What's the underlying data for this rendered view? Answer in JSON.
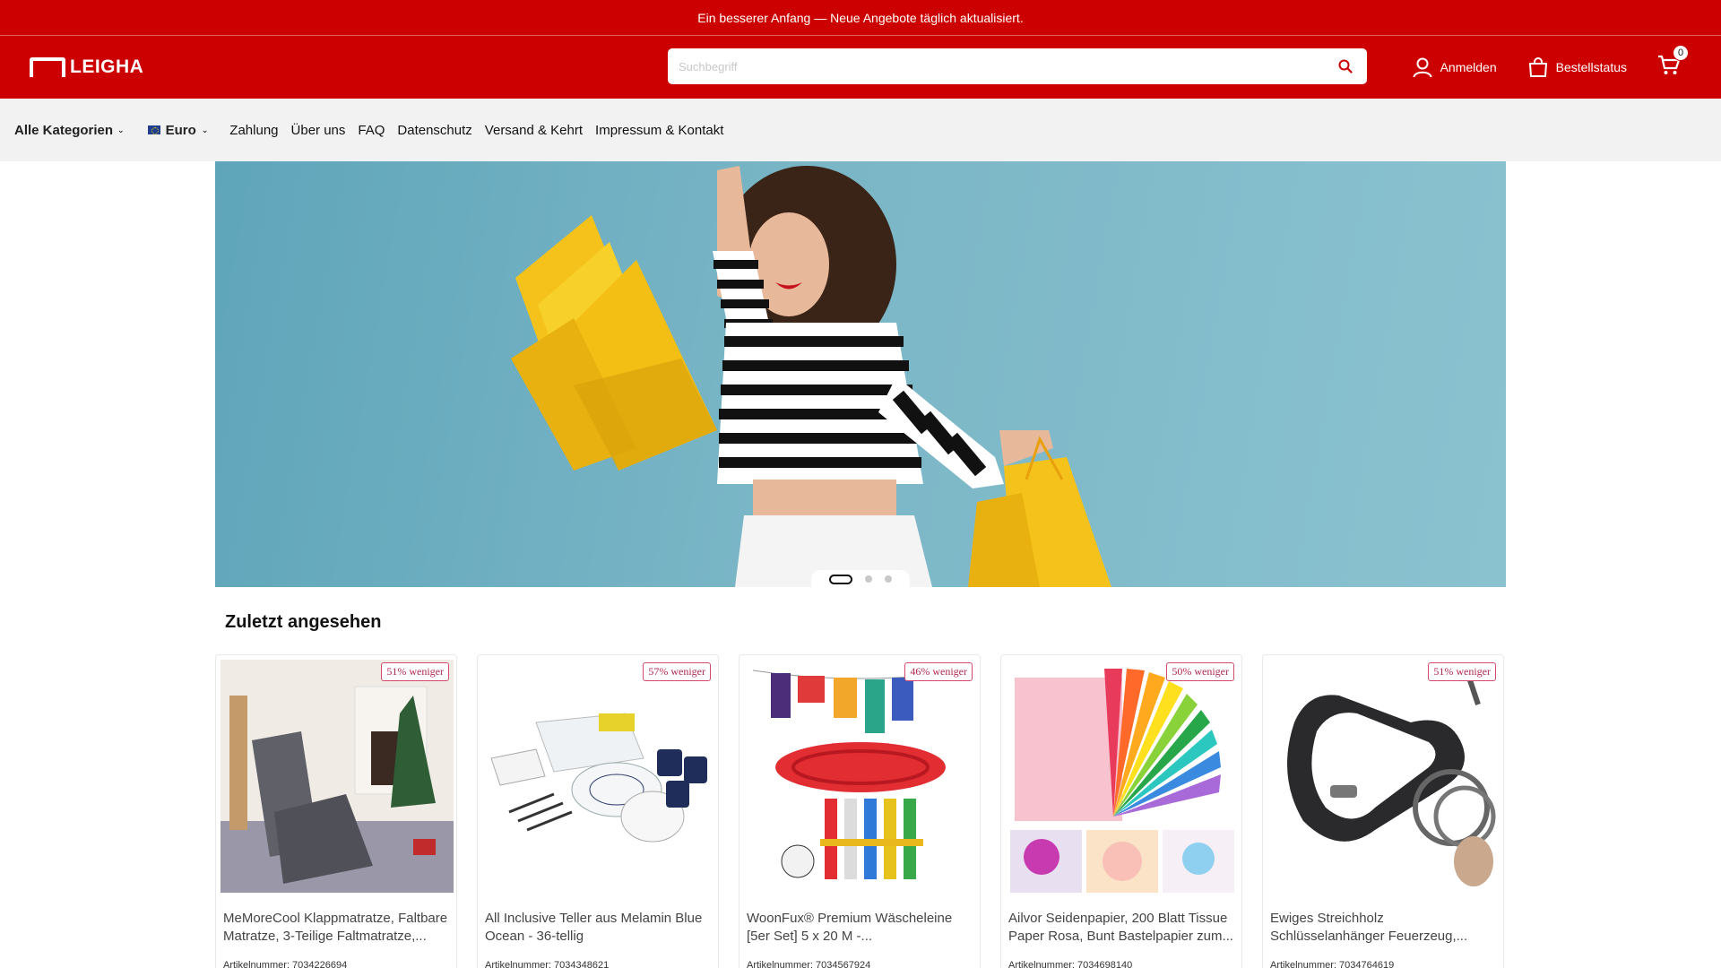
{
  "announcement": "Ein besserer Anfang — Neue Angebote täglich aktualisiert.",
  "header": {
    "logo_text": "LEIGHA",
    "search_placeholder": "Suchbegriff",
    "login_label": "Anmelden",
    "order_status_label": "Bestellstatus",
    "cart_count": "0"
  },
  "nav": {
    "categories_label": "Alle Kategorien",
    "currency_label": "Euro",
    "links": [
      "Zahlung",
      "Über uns",
      "FAQ",
      "Datenschutz",
      "Versand & Kehrt",
      "Impressum & Kontakt"
    ]
  },
  "hero": {
    "slide_count": 3,
    "active_slide": 1
  },
  "recent": {
    "title": "Zuletzt angesehen",
    "items": [
      {
        "discount": "51% weniger",
        "title": "MeMoreCool Klappmatratze, Faltbare Matratze, 3-Teilige Faltmatratze,...",
        "sku": "Artikelnummer: 7034226694"
      },
      {
        "discount": "57% weniger",
        "title": "All Inclusive Teller aus Melamin Blue Ocean - 36-tellig",
        "sku": "Artikelnummer: 7034348621"
      },
      {
        "discount": "46% weniger",
        "title": "WoonFux® Premium Wäscheleine [5er Set] 5 x 20 M -...",
        "sku": "Artikelnummer: 7034567924"
      },
      {
        "discount": "50% weniger",
        "title": "Ailvor Seidenpapier, 200 Blatt Tissue Paper Rosa, Bunt Bastelpapier zum...",
        "sku": "Artikelnummer: 7034698140"
      },
      {
        "discount": "51% weniger",
        "title": "Ewiges Streichholz Schlüsselanhänger Feuerzeug,...",
        "sku": "Artikelnummer: 7034764619"
      }
    ]
  },
  "colors": {
    "brand_red": "#cc0000",
    "nav_bg": "#f2f2f2",
    "hero_bg": "#7ab6c6",
    "badge": "#b02850"
  }
}
